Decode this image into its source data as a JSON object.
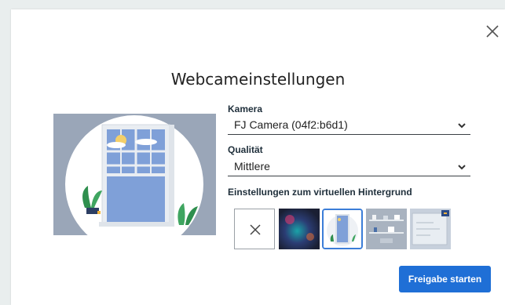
{
  "dialog": {
    "title": "Webcameinstellungen",
    "close_icon": "close-icon"
  },
  "camera": {
    "label": "Kamera",
    "value": "FJ Camera (04f2:b6d1)"
  },
  "quality": {
    "label": "Qualität",
    "value": "Mittlere"
  },
  "virtual_background": {
    "label": "Einstellungen zum virtuellen Hintergrund",
    "options": [
      {
        "name": "none",
        "icon": "close-icon"
      },
      {
        "name": "blur-image"
      },
      {
        "name": "window-illustration",
        "selected": true
      },
      {
        "name": "office-shelves"
      },
      {
        "name": "whiteboard-room"
      }
    ]
  },
  "actions": {
    "start_sharing": "Freigabe starten"
  },
  "colors": {
    "accent": "#1f6fd6",
    "selected_border": "#3b7dd8"
  }
}
